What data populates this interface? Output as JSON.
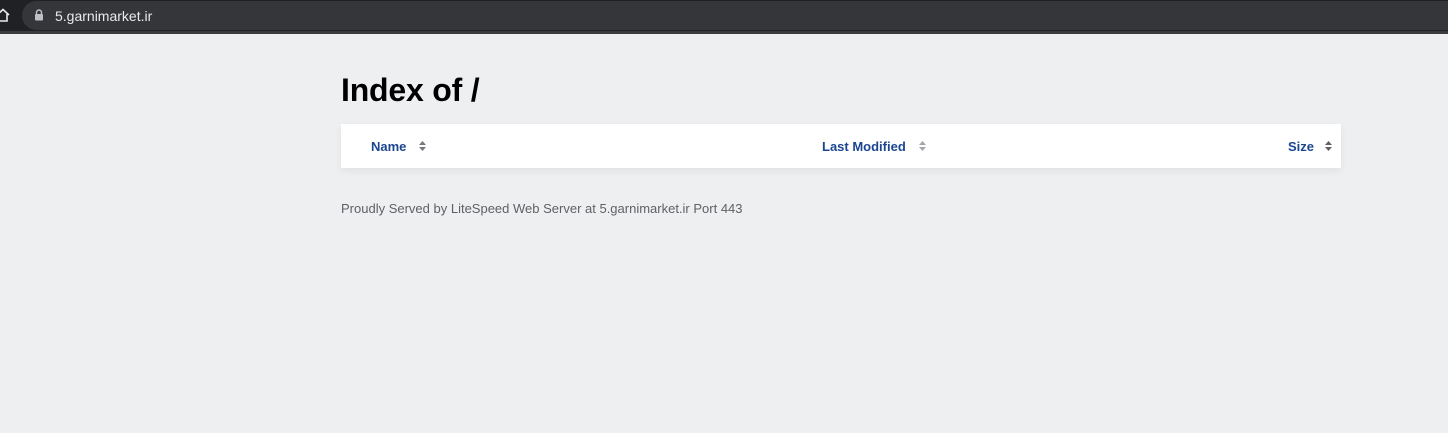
{
  "browser": {
    "url": "5.garnimarket.ir"
  },
  "page": {
    "title": "Index of /"
  },
  "table": {
    "columns": [
      "Name",
      "Last Modified",
      "Size"
    ]
  },
  "footer": {
    "text": "Proudly Served by LiteSpeed Web Server at 5.garnimarket.ir Port 443"
  },
  "colors": {
    "header_link": "#1a4690",
    "page_background": "#eeeff1",
    "browser_bar": "#202124"
  }
}
